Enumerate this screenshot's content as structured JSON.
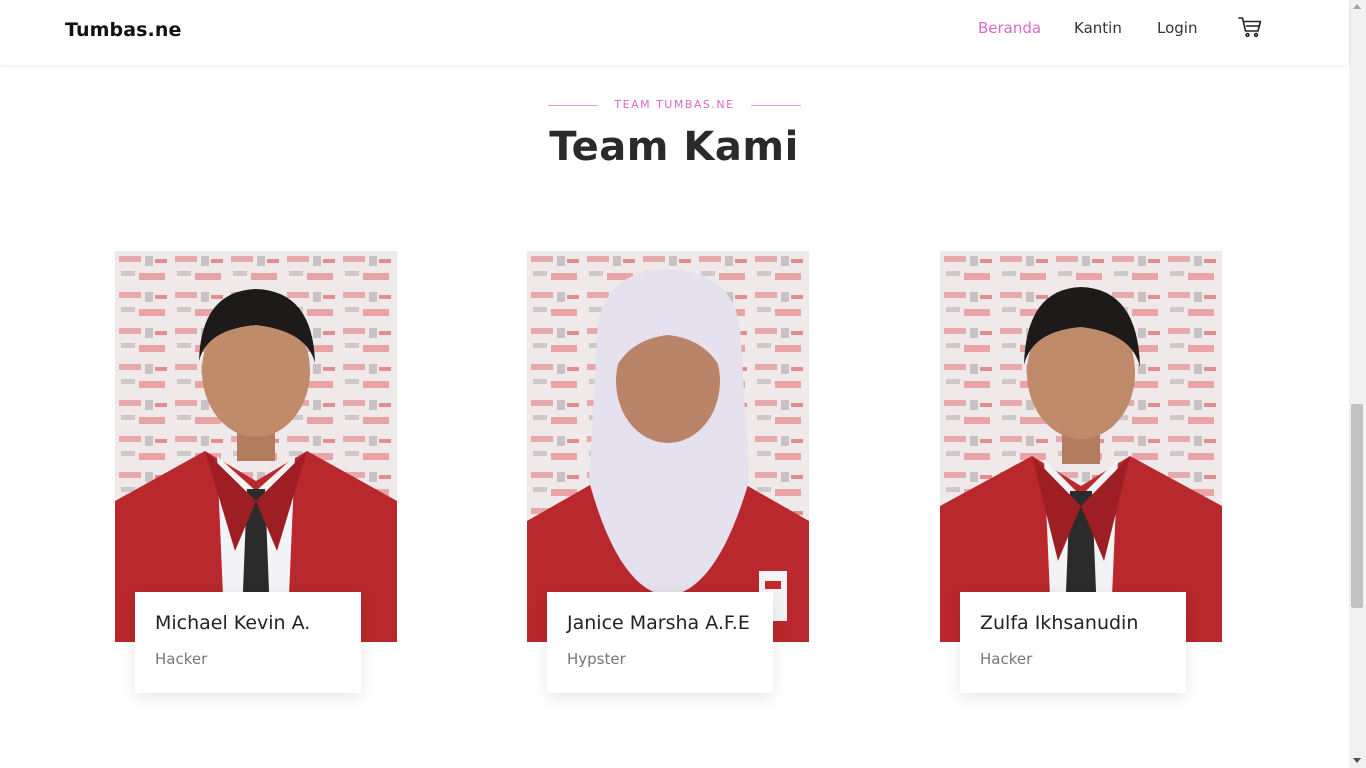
{
  "navbar": {
    "brand": "Tumbas.ne",
    "links": [
      {
        "label": "Beranda",
        "active": true
      },
      {
        "label": "Kantin",
        "active": false
      },
      {
        "label": "Login",
        "active": false
      }
    ],
    "cart_icon": "cart-icon"
  },
  "section": {
    "subtitle": "TEAM TUMBAS.NE",
    "title": "Team Kami"
  },
  "members": [
    {
      "name": "Michael Kevin A.",
      "role": "Hacker",
      "photo": "male-student-portrait"
    },
    {
      "name": "Janice Marsha A.F.E",
      "role": "Hypster",
      "photo": "female-student-hijab-portrait"
    },
    {
      "name": "Zulfa Ikhsanudin",
      "role": "Hacker",
      "photo": "male-student-portrait"
    }
  ],
  "colors": {
    "accent": "#d86acb",
    "blazer": "#b8282c",
    "backdrop": "#efe9ea"
  }
}
